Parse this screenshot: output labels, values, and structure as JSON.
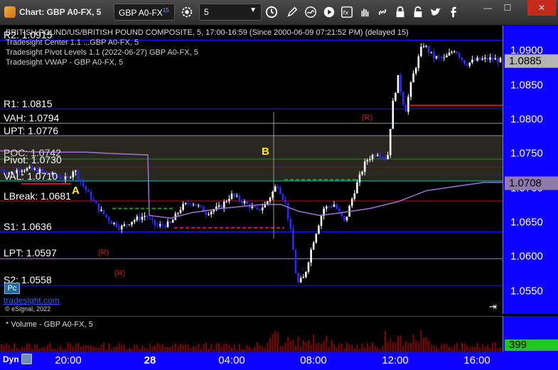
{
  "window": {
    "title": "Chart: GBP A0-FX, 5",
    "symbol": "GBP A0-FX",
    "symbol_superscript": "15",
    "interval": "5",
    "controls": [
      "minimize",
      "maximize",
      "close"
    ]
  },
  "toolbar": {
    "icons": [
      "settings-icon",
      "clock-icon",
      "pencil-icon",
      "swirl-icon",
      "play-icon",
      "fx-icon",
      "hand-icon",
      "link-icon",
      "lock-icon",
      "twitter-icon",
      "facebook-icon"
    ]
  },
  "chart": {
    "header_line": "BRITISH POUND/US/BRITISH POUND COMPOSITE, 5, 17:00-16:59 (Since 2000-06-09 07:21:52 PM) (delayed 15)",
    "legend": [
      "Tradesight Center 1.1 ...GBP A0-FX, 5",
      "Tradesight Pivot Levels 1.1 (2022-06-27) GBP A0-FX, 5",
      "Tradesight VWAP - GBP A0-FX, 5"
    ],
    "levels": [
      {
        "label": "R2: 1.0915",
        "value": 1.0915,
        "color": "#1a1aff"
      },
      {
        "label": "R1: 1.0815",
        "value": 1.0815,
        "color": "#1a1aff"
      },
      {
        "label": "VAH: 1.0794",
        "value": 1.0794,
        "color": "#22c0c0"
      },
      {
        "label": "UPT: 1.0776",
        "value": 1.0776,
        "color": "#9a86c8"
      },
      {
        "label": "POC: 1.0742",
        "value": 1.0742,
        "color": "#1e8a1e"
      },
      {
        "label": "Pivot: 1.0730",
        "value": 1.073,
        "color": "#1a1aff"
      },
      {
        "label": "VAL: 1.0710",
        "value": 1.071,
        "color": "#22c0c0"
      },
      {
        "label": "LBreak: 1.0681",
        "value": 1.0681,
        "color": "#c01818"
      },
      {
        "label": "S1: 1.0636",
        "value": 1.0636,
        "color": "#1a1aff"
      },
      {
        "label": "LPT: 1.0597",
        "value": 1.0597,
        "color": "#9a86c8"
      },
      {
        "label": "S2: 1.0558",
        "value": 1.0558,
        "color": "#1a1aff"
      }
    ],
    "annotations": [
      {
        "text": "A",
        "color": "#ffee00"
      },
      {
        "text": "B",
        "color": "#ffee00"
      },
      {
        "text": "(R)",
        "color": "#d01818"
      }
    ],
    "pc_label": "Pc",
    "brand": "tradesight.com",
    "copyright": "© eSignal, 2022"
  },
  "y_axis": {
    "ticks": [
      "1.0900",
      "1.0850",
      "1.0800",
      "1.0750",
      "1.0700",
      "1.0650",
      "1.0600",
      "1.0550"
    ],
    "tick_values": [
      1.09,
      1.085,
      1.08,
      1.075,
      1.07,
      1.065,
      1.06,
      1.055
    ],
    "last_price": "1.0885",
    "last_price_value": 1.0885,
    "vwap_tag": "1.0708",
    "vwap_tag_value": 1.0708
  },
  "indicator": {
    "title": "* Volume - GBP A0-FX, 5",
    "value": "399"
  },
  "x_axis": {
    "dyn_label": "Dyn",
    "ticks": [
      "20:00",
      "28",
      "04:00",
      "08:00",
      "12:00",
      "16:00"
    ]
  },
  "colors": {
    "axis_bg": "#0d00ff",
    "candle_up": "#ffffff",
    "candle_down": "#2a2aff",
    "vwap": "#a070d8",
    "volume": "#8b0000",
    "volume_tag": "#22c622"
  }
}
